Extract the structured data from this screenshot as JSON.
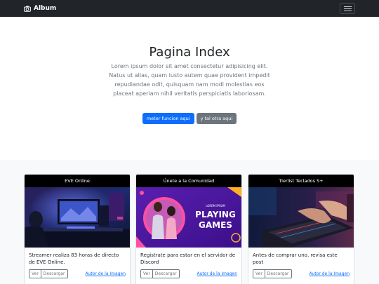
{
  "navbar": {
    "brand": "Album",
    "brand_icon": "camera-icon",
    "toggle_icon": "hamburger-menu-icon"
  },
  "hero": {
    "title": "Pagina Index",
    "lead": "Lorem ipsum dolor sit amet consectetur adipisicing elit. Natus ut alias, quam iusto autem quae provident impedit repudiandae odit, quisquam nam modi molestias eos placeat aperiam nihil veritatis perspiciatis laboriosam.",
    "primary_button": "meter funcion aqui",
    "secondary_button": "y tal otra aqui"
  },
  "cards": [
    {
      "header": "EVE Online",
      "image": "gaming-setup-photo",
      "text": "Streamer realiza 83 horas de directo de EVE Online.",
      "view": "Ver",
      "download": "Descargar",
      "author_link": "Autor de la Imagen"
    },
    {
      "header": "Únete a la Comunidad",
      "image": "playing-games-banner",
      "image_caption_small": "LOREM IPSUM",
      "image_caption_line1": "PLAYING",
      "image_caption_line2": "GAMES",
      "text": "Registrate para estar en el servidor de Discord",
      "view": "Ver",
      "download": "Descargar",
      "author_link": "Autor de la Imagen"
    },
    {
      "header": "Tierlist Teclados S+",
      "image": "keyboard-hands-photo",
      "text": "Antes de comprar uno, revisa este post",
      "view": "Ver",
      "download": "Descargar",
      "author_link": "Autor de la Imagen"
    }
  ],
  "colors": {
    "navbar": "#212529",
    "primary": "#0d6efd",
    "secondary": "#6c757d",
    "album_bg": "#f8f9fa",
    "card_header": "#000000"
  }
}
